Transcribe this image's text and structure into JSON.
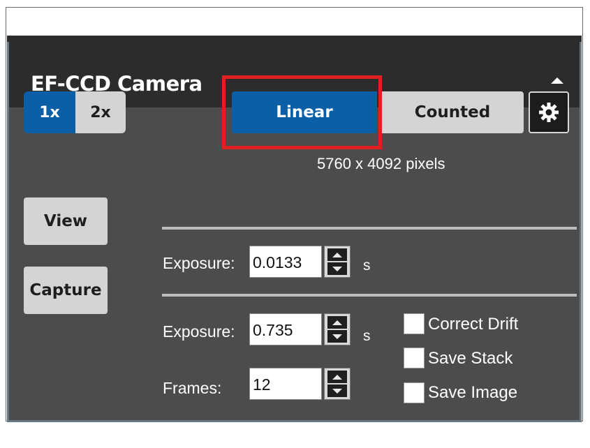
{
  "panel": {
    "title": "EF-CCD Camera",
    "collapse_icon": "triangle-up-icon"
  },
  "zoom": {
    "options": [
      "1x",
      "2x"
    ],
    "selected": "1x"
  },
  "mode": {
    "options": [
      "Linear",
      "Counted"
    ],
    "selected": "Linear",
    "settings_icon": "gear-icon"
  },
  "resolution": "5760 x 4092 pixels",
  "view": {
    "button_label": "View",
    "exposure_label": "Exposure:",
    "exposure_value": "0.0133",
    "unit": "s"
  },
  "capture": {
    "button_label": "Capture",
    "exposure_label": "Exposure:",
    "exposure_value": "0.735",
    "unit": "s",
    "frames_label": "Frames:",
    "frames_value": "12",
    "options": [
      {
        "label": "Correct Drift",
        "checked": false
      },
      {
        "label": "Save Stack",
        "checked": false
      },
      {
        "label": "Save Image",
        "checked": false
      }
    ]
  },
  "colors": {
    "accent": "#0b5fa6",
    "highlight": "#e02020",
    "panel_bg": "#4c4c4c",
    "header_bg": "#2c2c2c"
  }
}
